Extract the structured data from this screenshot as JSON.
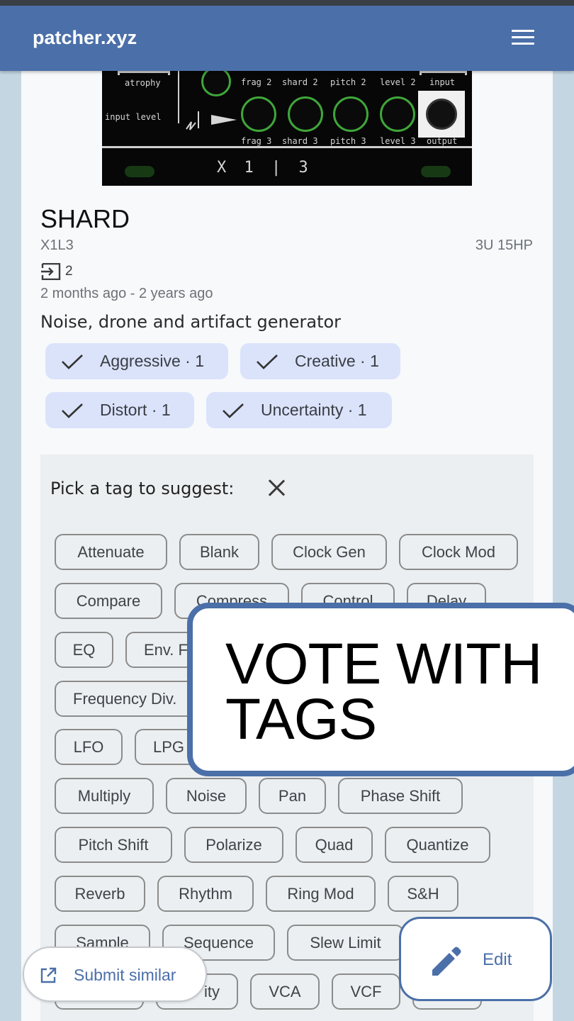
{
  "app": {
    "brand": "patcher.xyz",
    "menu_icon": "hamburger-menu-icon"
  },
  "module_image": {
    "labels": {
      "atrophy": "atrophy",
      "frag2": "frag 2",
      "shard2": "shard 2",
      "pitch2": "pitch 2",
      "level2": "level 2",
      "input": "input",
      "input_level": "input level",
      "frag3": "frag 3",
      "shard3": "shard 3",
      "pitch3": "pitch 3",
      "level3": "level 3",
      "output": "output",
      "logo": "X 1 | 3"
    }
  },
  "module": {
    "name": "SHARD",
    "maker": "X1L3",
    "size": "3U 15HP",
    "io_icon": "input-icon",
    "io_count": "2",
    "dates": "2 months ago - 2 years ago",
    "description": "Noise, drone and artifact generator"
  },
  "voted_tags": [
    {
      "label": "Aggressive · 1"
    },
    {
      "label": "Creative · 1"
    },
    {
      "label": "Distort · 1"
    },
    {
      "label": "Uncertainty · 1"
    }
  ],
  "suggest": {
    "label": "Pick a tag to suggest:",
    "tags": [
      "Attenuate",
      "Blank",
      "Clock Gen",
      "Clock Mod",
      "Compare",
      "Compress",
      "Control",
      "Delay",
      "EQ",
      "Env. F",
      "Frequency Div.",
      "LFO",
      "LPG",
      "Multiply",
      "Noise",
      "Pan",
      "Phase Shift",
      "Pitch Shift",
      "Polarize",
      "Quad",
      "Quantize",
      "Reverb",
      "Rhythm",
      "Ring Mod",
      "S&H",
      "Sample",
      "Sequence",
      "Slew Limit",
      "",
      "ity",
      "VCA",
      "VCF",
      ""
    ]
  },
  "promo": {
    "text": "VOTE WITH TAGS"
  },
  "actions": {
    "edit_label": "Edit",
    "submit_label": "Submit similar"
  }
}
